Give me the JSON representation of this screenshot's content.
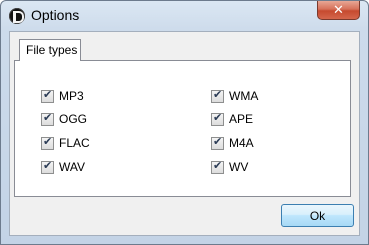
{
  "window": {
    "title": "Options",
    "close_glyph": "✕"
  },
  "tabs": [
    {
      "label": "File types"
    }
  ],
  "file_types": {
    "left": [
      {
        "label": "MP3",
        "checked": true
      },
      {
        "label": "OGG",
        "checked": true
      },
      {
        "label": "FLAC",
        "checked": true
      },
      {
        "label": "WAV",
        "checked": true
      }
    ],
    "right": [
      {
        "label": "WMA",
        "checked": true
      },
      {
        "label": "APE",
        "checked": true
      },
      {
        "label": "M4A",
        "checked": true
      },
      {
        "label": "WV",
        "checked": true
      }
    ]
  },
  "buttons": {
    "ok_label": "Ok"
  },
  "icons": {
    "app": "app-icon",
    "close": "close-icon",
    "check": "check-icon",
    "check_glyph": "✔"
  }
}
